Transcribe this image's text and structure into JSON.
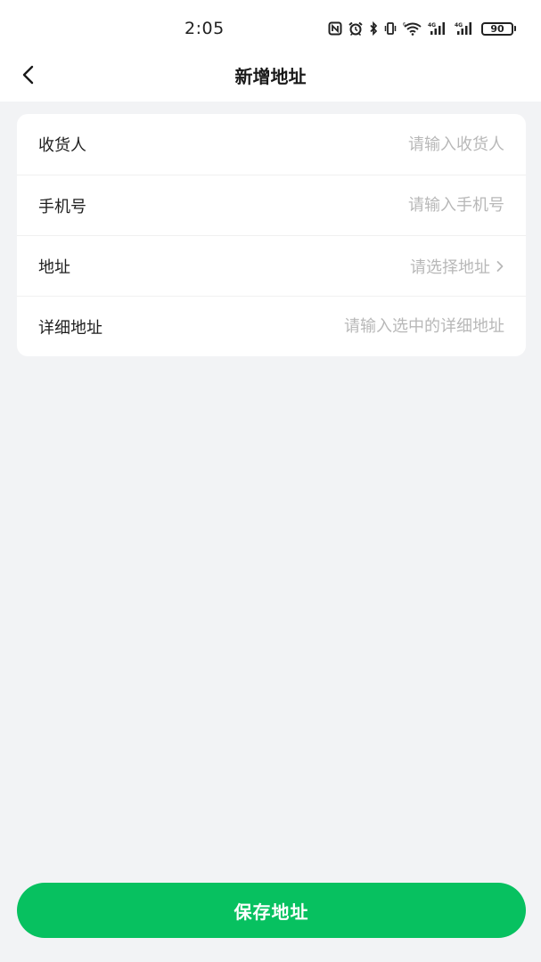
{
  "status_bar": {
    "time": "2:05",
    "battery": "90",
    "icons": [
      "nfc-icon",
      "alarm-icon",
      "bluetooth-icon",
      "vibrate-icon",
      "wifi-icon",
      "signal-4g-icon",
      "signal-4g-icon",
      "battery-icon"
    ]
  },
  "nav": {
    "title": "新增地址",
    "back_icon": "chevron-left-icon"
  },
  "form": {
    "consignee": {
      "label": "收货人",
      "value": "",
      "placeholder": "请输入收货人"
    },
    "phone": {
      "label": "手机号",
      "value": "",
      "placeholder": "请输入手机号"
    },
    "address": {
      "label": "地址",
      "placeholder": "请选择地址",
      "icon": "chevron-right-icon"
    },
    "detail_address": {
      "label": "详细地址",
      "value": "",
      "placeholder": "请输入选中的详细地址"
    }
  },
  "actions": {
    "save_label": "保存地址"
  },
  "colors": {
    "accent": "#07c160",
    "background": "#f2f3f5",
    "card": "#ffffff",
    "placeholder": "#b8b8b8"
  }
}
